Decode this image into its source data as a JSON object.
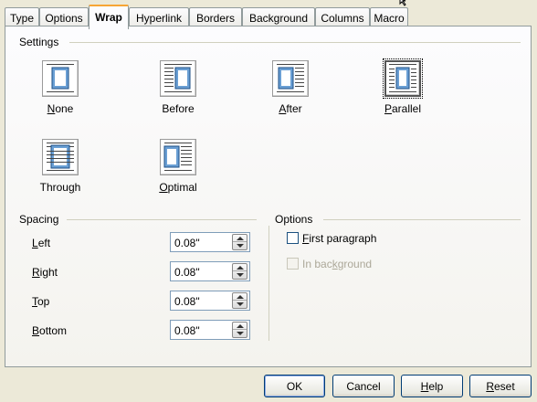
{
  "tabs": [
    {
      "label": "Type"
    },
    {
      "label": "Options"
    },
    {
      "label": "Wrap"
    },
    {
      "label": "Hyperlink"
    },
    {
      "label": "Borders"
    },
    {
      "label": "Background"
    },
    {
      "label": "Columns"
    },
    {
      "label": "Macro"
    }
  ],
  "active_tab": "Wrap",
  "settings": {
    "title": "Settings",
    "options": [
      {
        "key": "N",
        "rest": "one",
        "pre": "",
        "icon": "wrap-none-icon"
      },
      {
        "key": "",
        "rest": "Before",
        "pre": "",
        "icon": "wrap-before-icon"
      },
      {
        "key": "A",
        "rest": "fter",
        "pre": "",
        "icon": "wrap-after-icon"
      },
      {
        "key": "P",
        "rest": "arallel",
        "pre": "",
        "icon": "wrap-parallel-icon"
      },
      {
        "key": "g",
        "rest": "h",
        "pre": "Throu",
        "icon": "wrap-through-icon"
      },
      {
        "key": "O",
        "rest": "ptimal",
        "pre": "",
        "icon": "wrap-optimal-icon"
      }
    ],
    "selected": "Parallel"
  },
  "spacing": {
    "title": "Spacing",
    "fields": [
      {
        "key": "L",
        "rest": "eft",
        "value": "0.08\""
      },
      {
        "key": "R",
        "rest": "ight",
        "value": "0.08\""
      },
      {
        "key": "T",
        "rest": "op",
        "value": "0.08\""
      },
      {
        "key": "B",
        "rest": "ottom",
        "value": "0.08\""
      }
    ]
  },
  "options": {
    "title": "Options",
    "first_paragraph": {
      "key": "F",
      "rest": "irst paragraph",
      "checked": false
    },
    "in_background": {
      "pre": "In bac",
      "key": "k",
      "rest": "ground",
      "checked": false,
      "disabled": true
    }
  },
  "buttons": {
    "ok": "OK",
    "cancel": "Cancel",
    "help_key": "H",
    "help_rest": "elp",
    "reset_key": "R",
    "reset_rest": "eset"
  }
}
